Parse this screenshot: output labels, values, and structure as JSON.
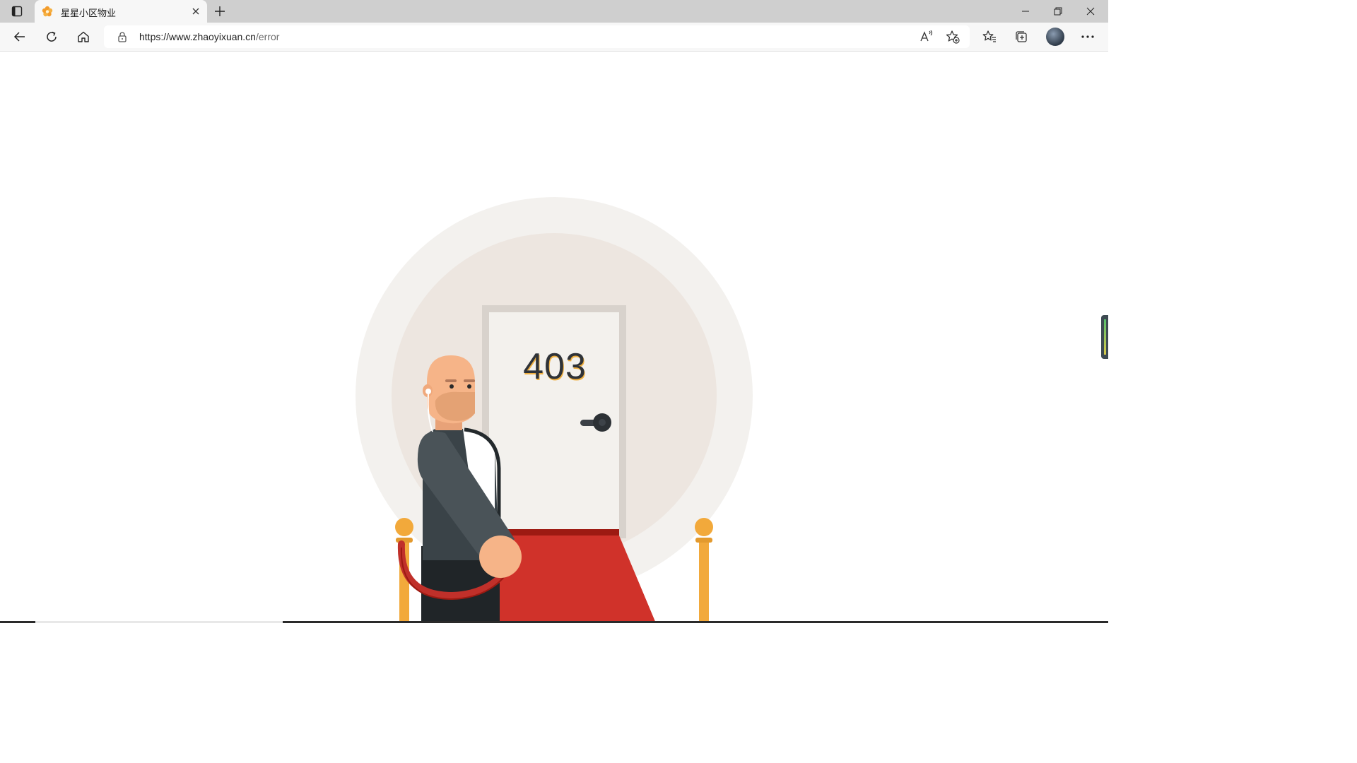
{
  "browser": {
    "tab": {
      "title": "星星小区物业",
      "favicon_icon": "orange-flower-icon",
      "close_icon": "close-icon"
    },
    "new_tab_icon": "plus-icon",
    "window_controls": [
      "minimize-icon",
      "restore-icon",
      "close-icon"
    ],
    "address": {
      "url_host": "https://www.zhaoyixuan.cn",
      "url_path": "/error",
      "lock_icon": "lock-icon"
    },
    "toolbar_icons": [
      "back-icon",
      "refresh-icon",
      "home-icon",
      "read-aloud-icon",
      "add-favorite-icon",
      "favorites-icon",
      "collections-icon",
      "profile-avatar",
      "more-icon"
    ]
  },
  "page": {
    "error_code": "403",
    "illustration": "guard-standing-by-door-icon",
    "colors": {
      "outer_circle": "#f3f1ee",
      "inner_circle": "#ede6e0",
      "door_frame": "#d8d2cc",
      "door": "#f2f0ec",
      "carpet": "#d0322a",
      "post": "#f2a93b",
      "rope": "#c0302a",
      "suit": "#4a5358",
      "skin": "#f6b488"
    }
  }
}
